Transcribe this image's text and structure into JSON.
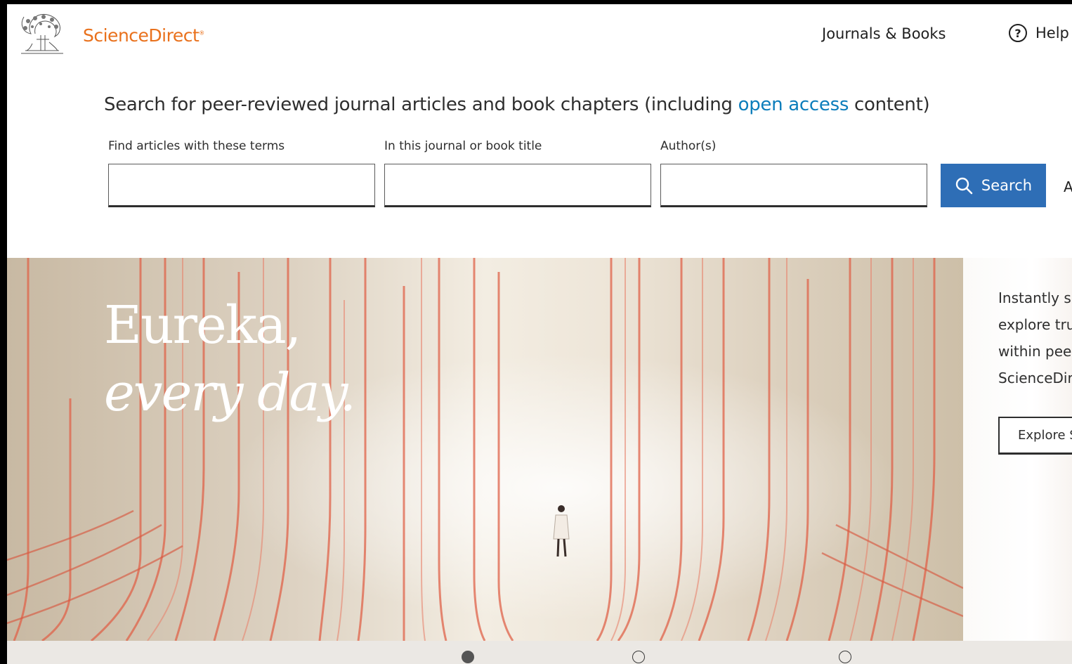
{
  "header": {
    "brand": "ScienceDirect",
    "brand_mark": "®",
    "nav": {
      "journals_books": "Journals & Books",
      "help": "Help",
      "help_icon": "?"
    }
  },
  "search": {
    "heading_before": "Search for peer-reviewed journal articles and book chapters (including ",
    "heading_link": "open access",
    "heading_after": " content)",
    "fields": [
      {
        "label": "Find articles with these terms",
        "value": ""
      },
      {
        "label": "In this journal or book title",
        "value": ""
      },
      {
        "label": "Author(s)",
        "value": ""
      }
    ],
    "button_label": "Search",
    "advanced_link": "A"
  },
  "hero": {
    "title_line1": "Eureka,",
    "title_line2": "every day.",
    "side_lines": [
      "Instantly s",
      "explore tru",
      "within pee",
      "ScienceDir"
    ],
    "explore_button": "Explore S"
  },
  "carousel": {
    "slide_count": 3,
    "active_index": 0
  },
  "colors": {
    "brand": "#e9711c",
    "link": "#0c7dbb",
    "search_button": "#2e6eb6"
  }
}
